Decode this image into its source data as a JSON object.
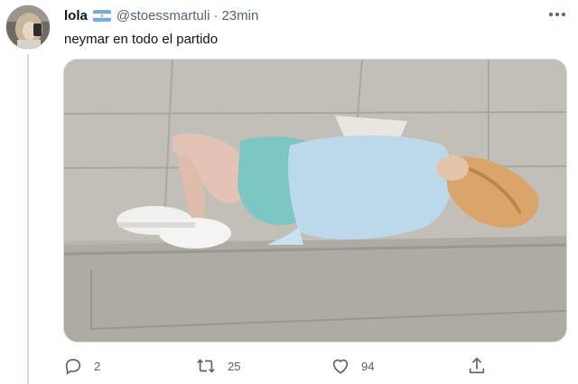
{
  "author": {
    "display_name": "lola",
    "flag_icon": "argentina-flag-icon",
    "handle": "@stoessmartuli",
    "separator": "·",
    "time": "23min"
  },
  "tweet": {
    "text": "neymar en todo el partido"
  },
  "more_icon": "more-options-icon",
  "actions": {
    "reply": {
      "icon": "reply-icon",
      "count": "2"
    },
    "retweet": {
      "icon": "retweet-icon",
      "count": "25"
    },
    "like": {
      "icon": "heart-icon",
      "count": "94"
    },
    "share": {
      "icon": "share-icon"
    }
  },
  "colors": {
    "text_primary": "#0f1419",
    "text_secondary": "#536471",
    "border": "#cfd9de",
    "flag_blue": "#74acdf"
  }
}
